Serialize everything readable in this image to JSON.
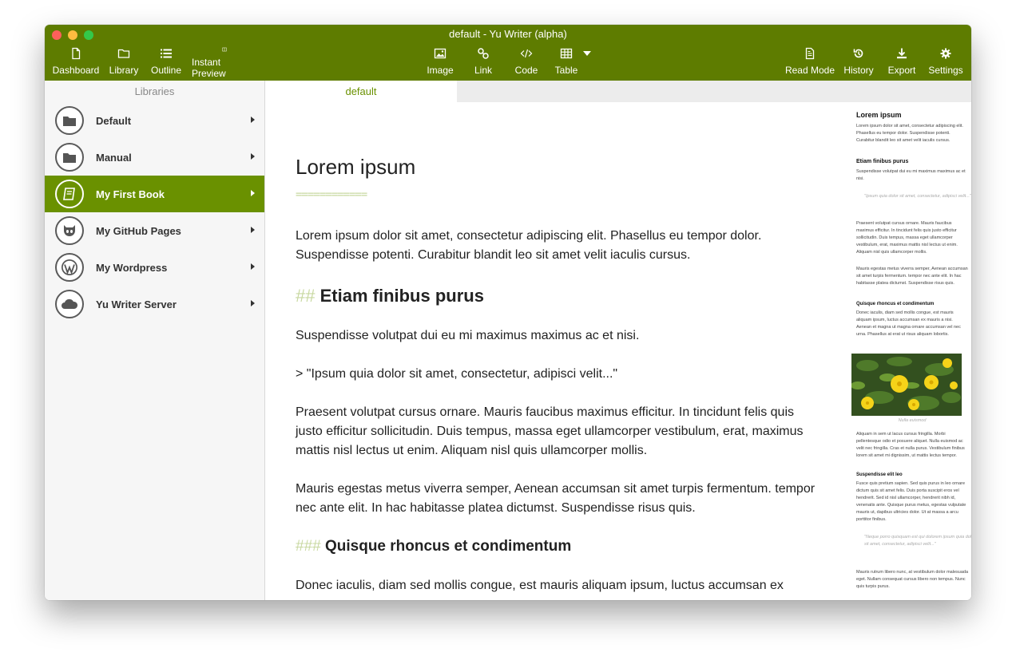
{
  "window": {
    "title": "default - Yu Writer (alpha)"
  },
  "toolbar": {
    "left": [
      {
        "label": "Dashboard",
        "icon": "file-icon"
      },
      {
        "label": "Library",
        "icon": "folder-icon"
      },
      {
        "label": "Outline",
        "icon": "list-icon"
      },
      {
        "label": "Instant Preview",
        "icon": "split-icon"
      }
    ],
    "center": [
      {
        "label": "Image",
        "icon": "image-icon"
      },
      {
        "label": "Link",
        "icon": "link-icon"
      },
      {
        "label": "Code",
        "icon": "code-icon"
      },
      {
        "label": "Table",
        "icon": "table-icon"
      }
    ],
    "right": [
      {
        "label": "Read Mode",
        "icon": "document-icon"
      },
      {
        "label": "History",
        "icon": "history-icon"
      },
      {
        "label": "Export",
        "icon": "download-icon"
      },
      {
        "label": "Settings",
        "icon": "gear-icon"
      }
    ]
  },
  "sidebar": {
    "title": "Libraries",
    "items": [
      {
        "label": "Default",
        "icon": "folder-icon",
        "active": false
      },
      {
        "label": "Manual",
        "icon": "folder-icon",
        "active": false
      },
      {
        "label": "My First Book",
        "icon": "book-icon",
        "active": true
      },
      {
        "label": "My GitHub Pages",
        "icon": "github-icon",
        "active": false
      },
      {
        "label": "My Wordpress",
        "icon": "wordpress-icon",
        "active": false
      },
      {
        "label": "Yu Writer Server",
        "icon": "cloud-icon",
        "active": false
      }
    ]
  },
  "tabs": [
    {
      "label": "default",
      "active": true
    }
  ],
  "editor": {
    "h1": "Lorem ipsum",
    "h1_underline": "============",
    "p1": "Lorem ipsum dolor sit amet, consectetur adipiscing elit. Phasellus eu tempor dolor. Suspendisse potenti. Curabitur blandit leo sit amet velit iaculis cursus.",
    "h2_mark": "##",
    "h2": "Etiam finibus purus",
    "p2": "Suspendisse volutpat dui eu mi maximus maximus ac et nisi.",
    "quote": "> \"Ipsum quia dolor sit amet, consectetur, adipisci velit...\"",
    "p3": "Praesent volutpat cursus ornare. Mauris faucibus maximus efficitur. In tincidunt felis quis justo efficitur sollicitudin. Duis tempus, massa eget ullamcorper vestibulum, erat, maximus mattis nisl lectus ut enim. Aliquam nisl quis ullamcorper mollis.",
    "p4": "Mauris egestas metus viverra semper, Aenean accumsan sit amet turpis fermentum. tempor nec ante elit. In hac habitasse platea dictumst. Suspendisse risus quis.",
    "h3_mark": "###",
    "h3": "Quisque rhoncus et condimentum",
    "p5": "Donec iaculis, diam sed mollis congue, est mauris aliquam ipsum, luctus accumsan ex"
  },
  "preview": {
    "h1": "Lorem ipsum",
    "p1": "Lorem ipsum dolor sit amet, consectetur adipiscing elit. Phasellus eu tempor dolor. Suspendisse potenti. Curabitur blandit leo sit amet velit iaculis cursus.",
    "h2": "Etiam finibus purus",
    "p2": "Suspendisse volutpat dui eu mi maximus maximus ac et nisi.",
    "quote1": "\"Ipsum quia dolor sit amet, consectetur, adipisci velit...\"",
    "p3": "Praesent volutpat cursus ornare. Mauris faucibus maximus efficitur. In tincidunt felis quis justo efficitur sollicitudin. Duis tempus, massa eget ullamcorper vestibulum, erat, maximus mattis nisl lectus ut enim. Aliquam nisl quis ullamcorper mollis.",
    "p4": "Mauris egestas metus viverra semper, Aenean accumsan sit amet turpis fermentum. tempor nec ante elit. In hac habitasse platea dictumst. Suspendisse risus quis.",
    "h3": "Quisque rhoncus et condimentum",
    "p5": "Donec iaculis, diam sed mollis congue, est mauris aliquam ipsum, luctus accumsan ex mauris a nisi. Aenean et magna ut magna ornare accumsan vel nec urna. Phasellus at erat ut risus aliquam lobortis.",
    "caption": "Nulla euismod",
    "p6": "Aliquam in sem ut lacus cursus fringilla. Morbi pellentesque odio et posuere aliquet. Nulla euismod ac velit nec fringilla. Cras et nulla purus. Vestibulum finibus lorem sit amet mi dignissim, ut mattis lectus tempor.",
    "h3b": "Suspendisse elit leo",
    "p7": "Fusce quis pretium sapien. Sed quis purus in leo ornare dictum quis sit amet felis. Duis porta suscipit eros vel hendrerit. Sed id nisl ullamcorper, hendrerit nibh id, venenatis ante. Quisque purus metus, egestas vulputate mauris ut, dapibus ultricies dolor. Ut at massa a arcu porttitor finibus.",
    "quote2": "\"Neque porro quisquam est qui dolorem ipsum quia dolor sit amet, consectetur, adipisci velit...\"",
    "p8": "Mauris rutrum libero nunc, at vestibulum dolor malesuada eget. Nullam consequat cursus libero non tempus. Nunc quis turpis purus."
  },
  "colors": {
    "brand": "#5e7c00",
    "active": "#6a9100",
    "accent_mark": "#c8d8a0"
  }
}
